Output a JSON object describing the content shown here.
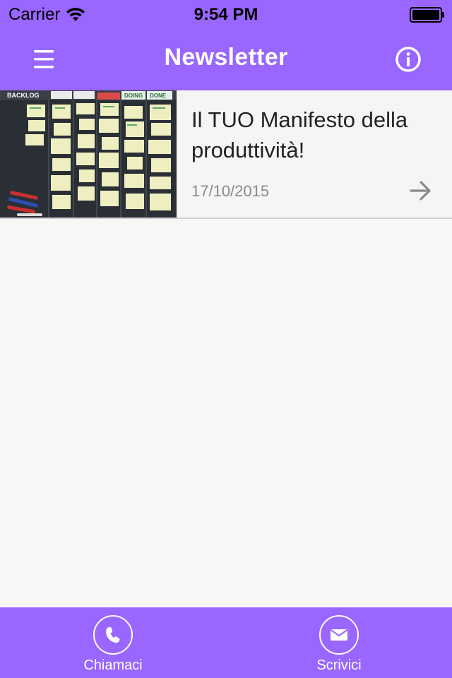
{
  "status_bar": {
    "carrier": "Carrier",
    "time": "9:54 PM",
    "icons": [
      "wifi-icon",
      "battery-icon"
    ]
  },
  "nav_bar": {
    "title": "Newsletter",
    "left_icon": "menu-icon",
    "right_icon": "info-icon"
  },
  "newsletters": [
    {
      "title": "Il TUO Manifesto della produttività!",
      "date": "17/10/2015",
      "thumbnail": "kanban-board-photo",
      "thumbnail_labels": [
        "BACKLOG",
        "DOING",
        "DONE"
      ],
      "icon": "arrow-right-icon"
    }
  ],
  "tab_bar": {
    "tabs": [
      {
        "label": "Chiamaci",
        "icon": "phone-icon"
      },
      {
        "label": "Scrivici",
        "icon": "envelope-icon"
      }
    ]
  },
  "colors": {
    "accent": "#9966ff",
    "background": "#f7f7f7",
    "text": "#222222",
    "date_text": "#8a8a8a"
  }
}
